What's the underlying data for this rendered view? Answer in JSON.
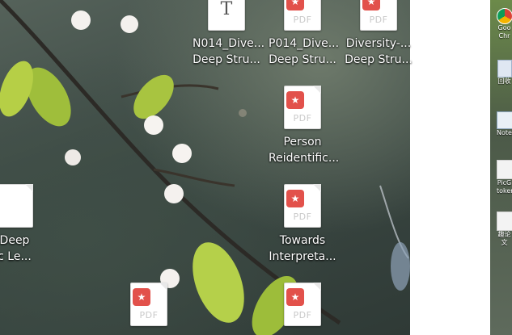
{
  "desktop": {
    "icons": [
      {
        "name": "desktop-file-n014",
        "type": "",
        "glyph": "T",
        "label": "N014_Dive...\nDeep Stru..."
      },
      {
        "name": "desktop-file-p014",
        "type": "PDF",
        "glyph": "★",
        "label": "P014_Dive...\nDeep Stru..."
      },
      {
        "name": "desktop-file-diversity",
        "type": "PDF",
        "glyph": "★",
        "label": "Diversity-...\nDeep Stru..."
      },
      {
        "name": "desktop-file-person-reid",
        "type": "PDF",
        "glyph": "★",
        "label": "Person\nReidentific..."
      },
      {
        "name": "desktop-file-deep-left",
        "type": "",
        "glyph": "",
        "label": "Deep\nc Le..."
      },
      {
        "name": "desktop-file-towards",
        "type": "PDF",
        "glyph": "★",
        "label": "Towards\nInterpreta..."
      },
      {
        "name": "desktop-file-bottom-1",
        "type": "PDF",
        "glyph": "★",
        "label": ""
      },
      {
        "name": "desktop-file-bottom-2",
        "type": "PDF",
        "glyph": "★",
        "label": ""
      }
    ]
  },
  "second_screen": {
    "icons": [
      {
        "name": "chrome-shortcut",
        "label": "Goo\nChr"
      },
      {
        "name": "recycle-bin",
        "label": "回收"
      },
      {
        "name": "notepad-shortcut",
        "label": "Notepa"
      },
      {
        "name": "pic-tokenizer",
        "label": "PicG\ntoken"
      },
      {
        "name": "paper-doc",
        "label": "趣论文"
      }
    ]
  },
  "colors": {
    "pdf_badge": "#e2514b"
  }
}
